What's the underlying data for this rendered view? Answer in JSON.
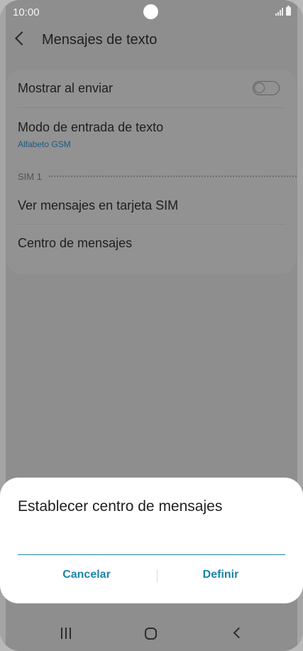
{
  "status_bar": {
    "time": "10:00",
    "icons": [
      "signal-icon",
      "battery-icon"
    ]
  },
  "header": {
    "title": "Mensajes de texto",
    "back_icon": "back-arrow-icon"
  },
  "settings": {
    "show_on_send": {
      "label": "Mostrar al enviar",
      "toggle_state": "off"
    },
    "input_mode": {
      "label": "Modo de entrada de texto",
      "value": "Alfabeto GSM"
    },
    "section_label": "SIM 1",
    "view_sim_messages": {
      "label": "Ver mensajes en tarjeta SIM"
    },
    "message_center": {
      "label": "Centro de mensajes"
    }
  },
  "dialog": {
    "title": "Establecer centro de mensajes",
    "input_value": "",
    "cancel_label": "Cancelar",
    "define_label": "Definir"
  },
  "nav_bar": {
    "icons": [
      "recents-icon",
      "home-icon",
      "back-icon"
    ]
  },
  "colors": {
    "accent": "#1d84a9",
    "scrim_background": "#8e8e8e",
    "dialog_background": "#ffffff"
  }
}
